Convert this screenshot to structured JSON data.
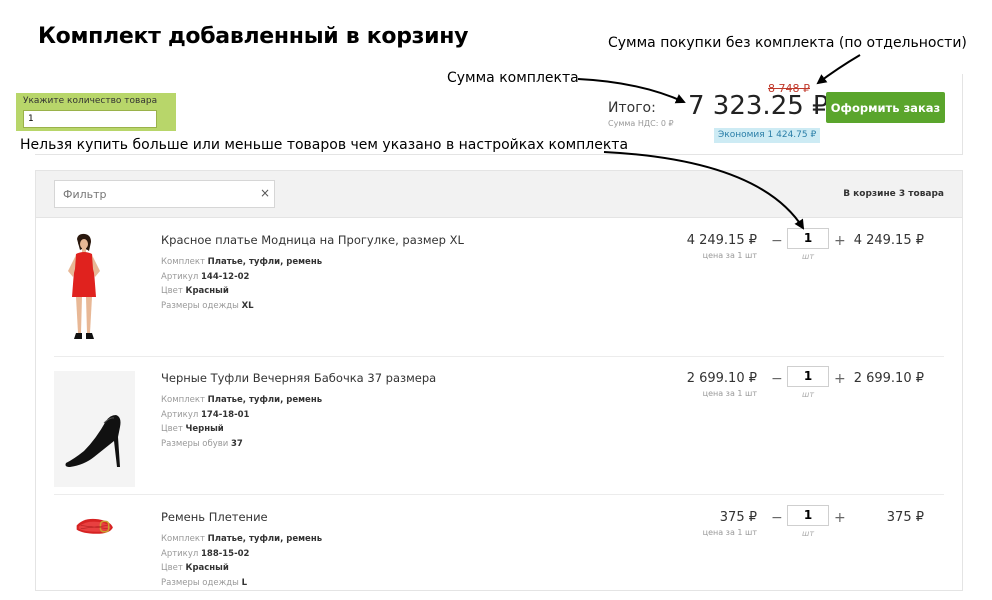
{
  "page_title": "Комплект добавленный в корзину",
  "annotations": {
    "no_set_sum": "Сумма покупки без комплекта (по отдельности)",
    "set_sum": "Сумма комплекта",
    "qty_limit": "Нельзя купить больше или меньше товаров чем указано в настройках комплекта"
  },
  "qty_setting": {
    "label": "Укажите количество товара",
    "value": "1"
  },
  "totals": {
    "label": "Итого:",
    "vat": "Сумма НДС: 0 ₽",
    "old_price": "8 748 ₽",
    "price": "7 323.25 ₽",
    "savings": "Экономия 1 424.75 ₽",
    "checkout_label": "Оформить заказ"
  },
  "cart": {
    "filter_placeholder": "Фильтр",
    "filter_clear": "×",
    "count_text": "В корзине 3 товара",
    "items": [
      {
        "name": "Красное платье Модница на Прогулке, размер XL",
        "props": [
          {
            "label": "Комплект",
            "value": "Платье, туфли, ремень"
          },
          {
            "label": "Артикул",
            "value": "144-12-02"
          },
          {
            "label": "Цвет",
            "value": "Красный"
          },
          {
            "label": "Размеры одежды",
            "value": "XL"
          }
        ],
        "price": "4 249.15 ₽",
        "price_note": "цена за 1 шт",
        "qty": "1",
        "qty_unit": "шт",
        "sum": "4 249.15 ₽",
        "image": "red-dress-photo"
      },
      {
        "name": "Черные Туфли Вечерняя Бабочка 37 размера",
        "props": [
          {
            "label": "Комплект",
            "value": "Платье, туфли, ремень"
          },
          {
            "label": "Артикул",
            "value": "174-18-01"
          },
          {
            "label": "Цвет",
            "value": "Черный"
          },
          {
            "label": "Размеры обуви",
            "value": "37"
          }
        ],
        "price": "2 699.10 ₽",
        "price_note": "цена за 1 шт",
        "qty": "1",
        "qty_unit": "шт",
        "sum": "2 699.10 ₽",
        "image": "black-heels-photo"
      },
      {
        "name": "Ремень Плетение",
        "props": [
          {
            "label": "Комплект",
            "value": "Платье, туфли, ремень"
          },
          {
            "label": "Артикул",
            "value": "188-15-02"
          },
          {
            "label": "Цвет",
            "value": "Красный"
          },
          {
            "label": "Размеры одежды",
            "value": "L"
          }
        ],
        "price": "375 ₽",
        "price_note": "цена за 1 шт",
        "qty": "1",
        "qty_unit": "шт",
        "sum": "375 ₽",
        "image": "red-belt-photo"
      }
    ],
    "qty_minus": "−",
    "qty_plus": "+"
  },
  "colors": {
    "checkout_button": "#5aa52c",
    "qty_setting_bg": "#b8d66a",
    "old_price": "#c0392b",
    "savings_bg": "#cdebf4",
    "savings_text": "#2b7fa8"
  }
}
